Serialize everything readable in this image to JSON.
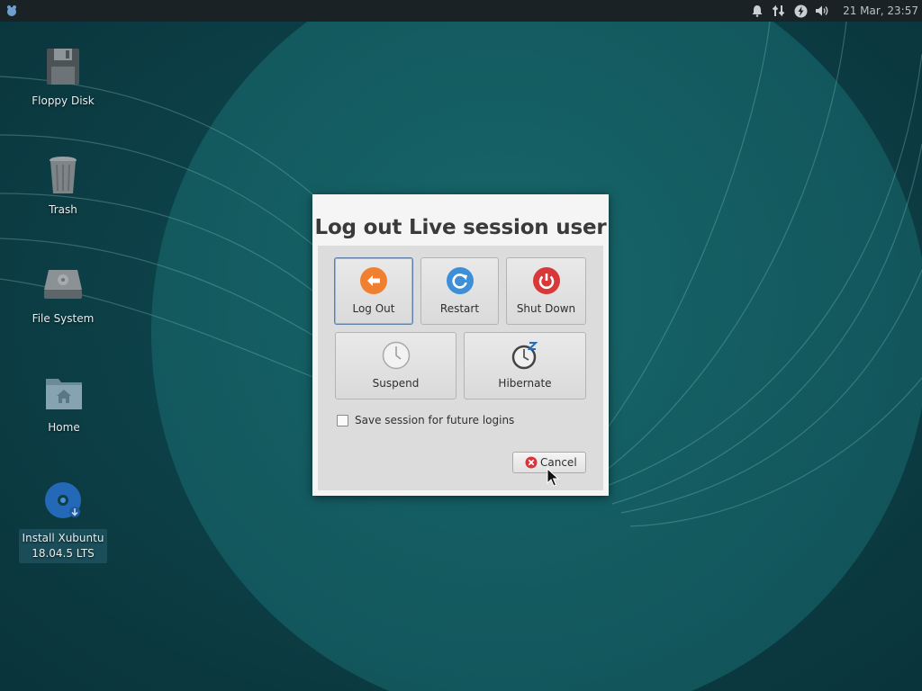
{
  "panel": {
    "menu_icon": "xfce-mouse-icon",
    "tray_icons": [
      "notification-bell-icon",
      "network-updown-icon",
      "power-bolt-icon",
      "volume-icon"
    ],
    "clock": "21 Mar, 23:57"
  },
  "desktop": {
    "icons": [
      {
        "label": "Floppy Disk",
        "icon": "floppy-disk-icon"
      },
      {
        "label": "Trash",
        "icon": "trash-icon"
      },
      {
        "label": "File System",
        "icon": "hard-drive-icon"
      },
      {
        "label": "Home",
        "icon": "home-folder-icon"
      },
      {
        "label": "Install Xubuntu",
        "label2": "18.04.5 LTS",
        "icon": "install-disc-icon"
      }
    ]
  },
  "dialog": {
    "title": "Log out Live session user",
    "actions": [
      {
        "label": "Log Out",
        "icon": "logout-arrow-icon",
        "color": "#f08030"
      },
      {
        "label": "Restart",
        "icon": "restart-icon",
        "color": "#3d8fd8"
      },
      {
        "label": "Shut Down",
        "icon": "power-icon",
        "color": "#d93838"
      },
      {
        "label": "Suspend",
        "icon": "clock-icon"
      },
      {
        "label": "Hibernate",
        "icon": "hibernate-icon"
      }
    ],
    "save_session_label": "Save session for future logins",
    "save_session_checked": false,
    "cancel_label": "Cancel"
  },
  "colors": {
    "background": "#0d3f47",
    "panel": "#1b2226",
    "dialog": "#f5f5f5"
  }
}
